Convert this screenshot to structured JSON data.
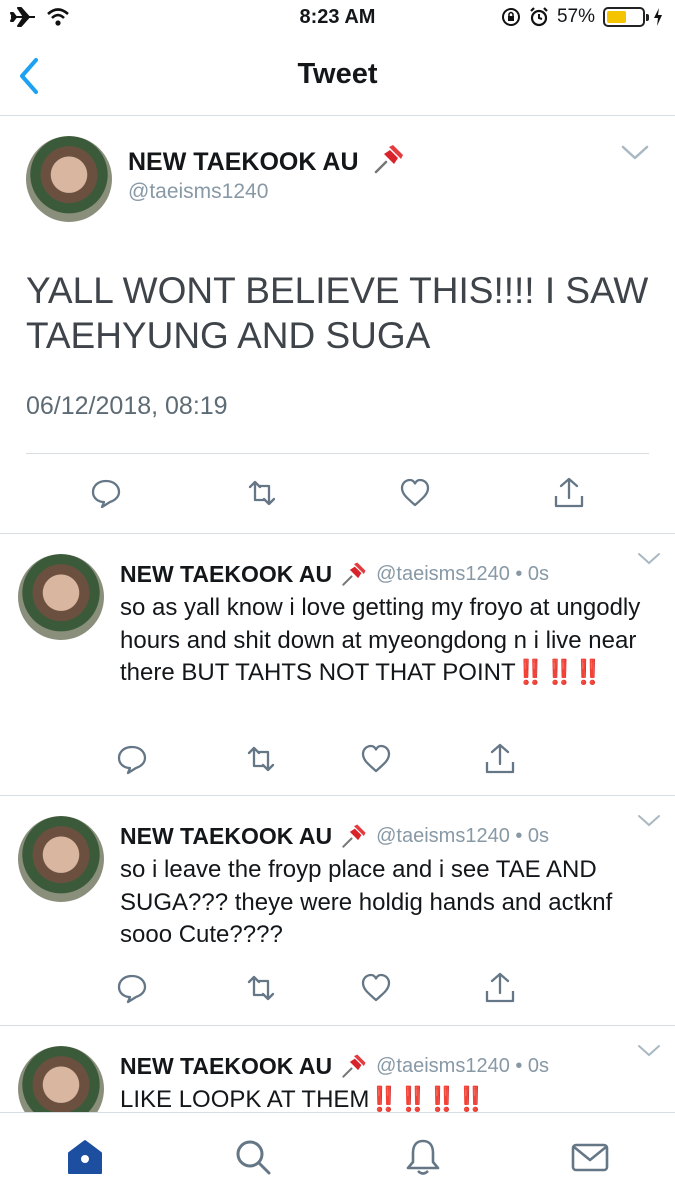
{
  "status_bar": {
    "time": "8:23 AM",
    "battery": "57%",
    "battery_level": 0.57
  },
  "nav": {
    "title": "Tweet"
  },
  "main_tweet": {
    "name": "NEW TAEKOOK AU",
    "handle": "@taeisms1240",
    "text": "YALL WONT BELIEVE THIS!!!! I SAW TAEHYUNG AND SUGA",
    "timestamp": "06/12/2018, 08:19"
  },
  "replies": [
    {
      "name": "NEW TAEKOOK AU",
      "meta": "@taeisms1240 • 0s",
      "text": "so as yall know i love getting my froyo at ungodly hours and shit down at myeongdong n i live near there BUT TAHTS NOT THAT POINT",
      "emphasis": "‼️‼️‼️"
    },
    {
      "name": "NEW TAEKOOK AU",
      "meta": "@taeisms1240 • 0s",
      "text": "so i leave the froyp place and i see TAE AND SUGA??? theye were holdig hands and actknf sooo Cute????",
      "emphasis": ""
    },
    {
      "name": "NEW TAEKOOK AU",
      "meta": "@taeisms1240 • 0s",
      "text": "LIKE LOOPK AT THEM",
      "emphasis": "‼️‼️‼️‼️"
    }
  ],
  "icons": {
    "pin": "pushpin-icon",
    "reply": "reply-icon",
    "retweet": "retweet-icon",
    "like": "heart-icon",
    "share": "share-icon"
  },
  "tabs": [
    "home-icon",
    "search-icon",
    "notifications-icon",
    "messages-icon"
  ],
  "colors": {
    "accent": "#1da1f2",
    "home_active": "#1c4fa0",
    "muted": "#8899a6",
    "alert": "#e0111a"
  }
}
